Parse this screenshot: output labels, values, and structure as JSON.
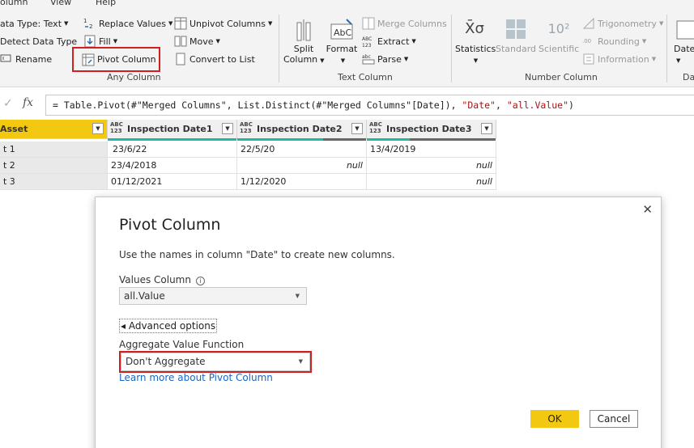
{
  "ribbon": {
    "top_tabs": [
      "olumn",
      "View",
      "Help"
    ],
    "left_group": {
      "data_type": "ata Type: Text",
      "detect_data_type": "Detect Data Type",
      "rename": "Rename"
    },
    "any_column": {
      "replace_values": "Replace Values",
      "fill": "Fill",
      "pivot_column": "Pivot Column",
      "unpivot_columns": "Unpivot Columns",
      "move": "Move",
      "convert_to_list": "Convert to List",
      "group_label": "Any Column"
    },
    "text_column": {
      "split_column_line1": "Split",
      "split_column_line2": "Column",
      "format": "Format",
      "abc_glyph": "AbC",
      "merge_columns": "Merge Columns",
      "extract": "Extract",
      "parse": "Parse",
      "group_label": "Text Column"
    },
    "number_column": {
      "statistics": "Statistics",
      "standard": "Standard",
      "scientific": "Scientific",
      "trigonometry": "Trigonometry",
      "rounding": "Rounding",
      "information": "Information",
      "group_label": "Number Column",
      "sigma": "X̄σ",
      "sci_glyph": "10²",
      "round_glyph": ".00"
    },
    "date_col": {
      "date_label": "Date",
      "group_label": "Da"
    }
  },
  "formula": {
    "fx": "fx",
    "cross": "✓",
    "prefix": "= Table.Pivot(#\"Merged Columns\", List.Distinct(#\"Merged Columns\"[Date]), ",
    "arg1": "\"Date\"",
    "comma": ", ",
    "arg2": "\"all.Value\"",
    "suffix": ")"
  },
  "table": {
    "type_glyph_top": "ABC",
    "type_glyph_bottom": "123",
    "filter_glyph": "▼",
    "headers": [
      "Asset",
      "Inspection Date1",
      "Inspection Date2",
      "Inspection Date3"
    ],
    "rows": [
      [
        "t 1",
        "23/6/22",
        "22/5/20",
        "13/4/2019"
      ],
      [
        "t 2",
        "23/4/2018",
        "null",
        "null"
      ],
      [
        "t 3",
        "01/12/2021",
        "1/12/2020",
        "null"
      ]
    ]
  },
  "dialog": {
    "title": "Pivot Column",
    "close": "✕",
    "description": "Use the names in column \"Date\" to create new columns.",
    "values_column_label": "Values Column",
    "info_glyph": "i",
    "values_column_value": "all.Value",
    "advanced_options": "◂ Advanced options",
    "aggregate_label": "Aggregate Value Function",
    "aggregate_value": "Don't Aggregate",
    "learn_more": "Learn more about Pivot Column",
    "ok": "OK",
    "cancel": "Cancel",
    "caret": "▾"
  },
  "colors": {
    "accent_yellow": "#F2C811",
    "teal_quality": "#1FB8A8",
    "highlight_red": "#D11F1F",
    "link_blue": "#1A66C1"
  }
}
